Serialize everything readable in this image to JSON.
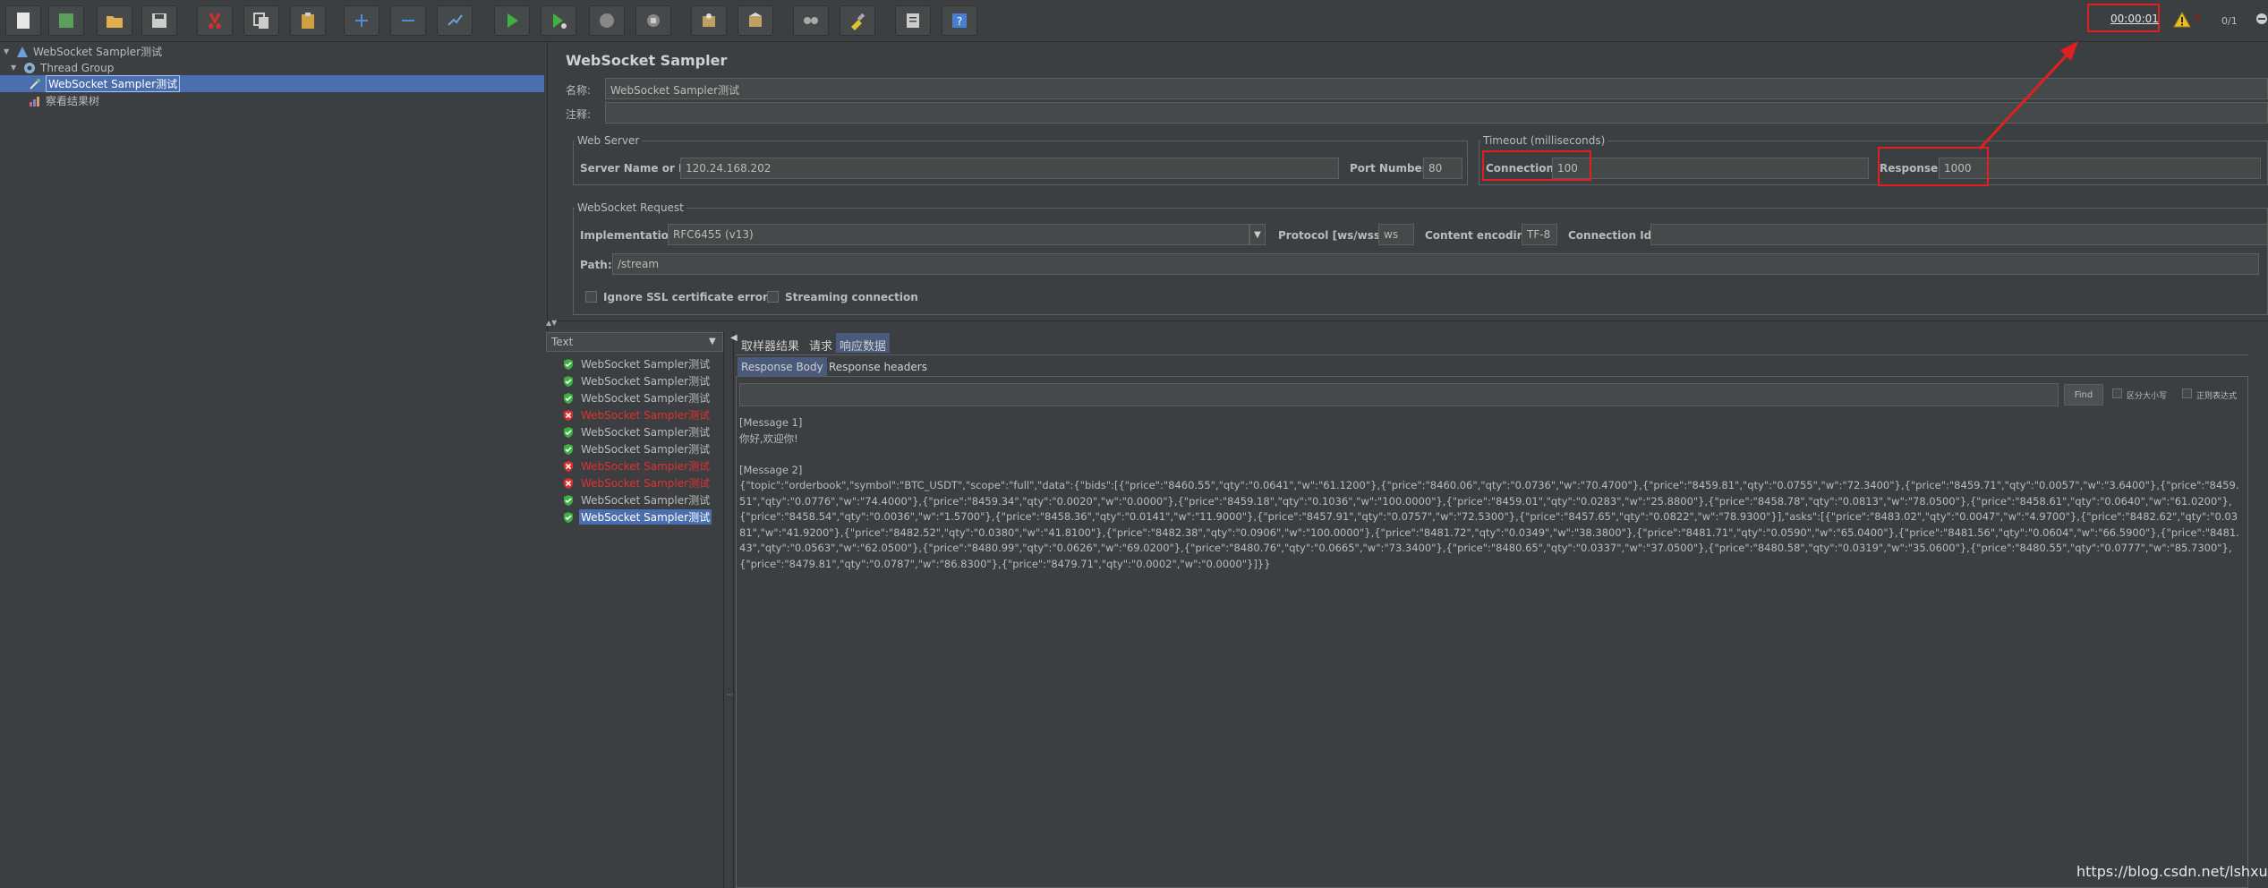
{
  "toolbar": {
    "buttons": [
      {
        "name": "new-icon",
        "color": "#e8e8e8"
      },
      {
        "name": "templates-icon",
        "color": "#5aa05a"
      },
      {
        "name": "open-icon",
        "color": "#e0b050"
      },
      {
        "name": "save-icon",
        "color": "#cccccc"
      },
      {
        "name": "cut-icon",
        "color": "#d03030"
      },
      {
        "name": "copy-icon",
        "color": "#cccccc"
      },
      {
        "name": "paste-icon",
        "color": "#d0a040"
      },
      {
        "name": "expand-icon",
        "color": "#4a8fd8"
      },
      {
        "name": "collapse-icon",
        "color": "#4a8fd8"
      },
      {
        "name": "toggle-icon",
        "color": "#6a9fd8"
      },
      {
        "name": "start-icon",
        "color": "#40b040"
      },
      {
        "name": "start-no-pauses-icon",
        "color": "#40b040"
      },
      {
        "name": "stop-icon",
        "color": "#888888"
      },
      {
        "name": "shutdown-icon",
        "color": "#888888"
      },
      {
        "name": "clear-icon",
        "color": "#c0a060"
      },
      {
        "name": "clear-all-icon",
        "color": "#c0a060"
      },
      {
        "name": "search-icon",
        "color": "#aaaaaa"
      },
      {
        "name": "reset-search-icon",
        "color": "#e0c030"
      },
      {
        "name": "function-helper-icon",
        "color": "#cccccc"
      },
      {
        "name": "help-icon",
        "color": "#4a7fd0"
      }
    ],
    "timer": "00:00:01",
    "warning_count": "0",
    "thread_count": "0/1"
  },
  "tree": {
    "items": [
      {
        "label": "WebSocket Sampler测试",
        "level": 0,
        "icon": "test-plan-icon"
      },
      {
        "label": "Thread Group",
        "level": 1,
        "icon": "thread-group-icon"
      },
      {
        "label": "WebSocket Sampler测试",
        "level": 2,
        "icon": "sampler-icon",
        "selected": true
      },
      {
        "label": "察看结果树",
        "level": 2,
        "icon": "listener-icon"
      }
    ]
  },
  "sampler": {
    "title": "WebSocket Sampler",
    "name_label": "名称:",
    "name_value": "WebSocket Sampler测试",
    "comment_label": "注释:",
    "comment_value": "",
    "web_server": {
      "legend": "Web Server",
      "server_label": "Server Name or IP:",
      "server_value": "120.24.168.202",
      "port_label": "Port Number:",
      "port_value": "80"
    },
    "timeout": {
      "legend": "Timeout (milliseconds)",
      "connection_label": "Connection:",
      "connection_value": "100",
      "response_label": "Response:",
      "response_value": "1000"
    },
    "request": {
      "legend": "WebSocket Request",
      "impl_label": "Implementation:",
      "impl_value": "RFC6455 (v13)",
      "protocol_label": "Protocol [ws/wss]:",
      "protocol_value": "ws",
      "encoding_label": "Content encoding:",
      "encoding_value": "TF-8",
      "conn_id_label": "Connection Id:",
      "conn_id_value": "",
      "path_label": "Path:",
      "path_value": "/stream",
      "ignore_ssl_label": "Ignore SSL certificate errors",
      "streaming_label": "Streaming connection"
    }
  },
  "results": {
    "renderer": "Text",
    "items": [
      {
        "label": "WebSocket Sampler测试",
        "status": "ok"
      },
      {
        "label": "WebSocket Sampler测试",
        "status": "ok"
      },
      {
        "label": "WebSocket Sampler测试",
        "status": "ok"
      },
      {
        "label": "WebSocket Sampler测试",
        "status": "err"
      },
      {
        "label": "WebSocket Sampler测试",
        "status": "ok"
      },
      {
        "label": "WebSocket Sampler测试",
        "status": "ok"
      },
      {
        "label": "WebSocket Sampler测试",
        "status": "err"
      },
      {
        "label": "WebSocket Sampler测试",
        "status": "err"
      },
      {
        "label": "WebSocket Sampler测试",
        "status": "ok"
      },
      {
        "label": "WebSocket Sampler测试",
        "status": "ok",
        "selected": true
      }
    ]
  },
  "response": {
    "tabs": [
      "取样器结果",
      "请求",
      "响应数据"
    ],
    "active_tab": 2,
    "subtabs": [
      "Response Body",
      "Response headers"
    ],
    "active_subtab": 0,
    "find_label": "Find",
    "case_sensitive_label": "区分大小写",
    "regex_label": "正则表达式",
    "lines": [
      "[Message 1]",
      "你好,欢迎你!",
      "",
      "[Message 2]",
      "{\"topic\":\"orderbook\",\"symbol\":\"BTC_USDT\",\"scope\":\"full\",\"data\":{\"bids\":[{\"price\":\"8460.55\",\"qty\":\"0.0641\",\"w\":\"61.1200\"},{\"price\":\"8460.06\",\"qty\":\"0.0736\",\"w\":\"70.4700\"},{\"price\":\"8459.81\",\"qty\":\"0.0755\",\"w\":\"72.3400\"},{\"price\":\"8459.71\",\"qty\":\"0.0057\",\"w\":\"3.6400\"},{\"price\":\"8459.51\",\"qty\":\"0.0776\",\"w\":\"74.4000\"},{\"price\":\"8459.34\",\"qty\":\"0.0020\",\"w\":\"0.0000\"},{\"price\":\"8459.18\",\"qty\":\"0.1036\",\"w\":\"100.0000\"},{\"price\":\"8459.01\",\"qty\":\"0.0283\",\"w\":\"25.8800\"},{\"price\":\"8458.78\",\"qty\":\"0.0813\",\"w\":\"78.0500\"},{\"price\":\"8458.61\",\"qty\":\"0.0640\",\"w\":\"61.0200\"},{\"price\":\"8458.54\",\"qty\":\"0.0036\",\"w\":\"1.5700\"},{\"price\":\"8458.36\",\"qty\":\"0.0141\",\"w\":\"11.9000\"},{\"price\":\"8457.91\",\"qty\":\"0.0757\",\"w\":\"72.5300\"},{\"price\":\"8457.65\",\"qty\":\"0.0822\",\"w\":\"78.9300\"}],\"asks\":[{\"price\":\"8483.02\",\"qty\":\"0.0047\",\"w\":\"4.9700\"},{\"price\":\"8482.62\",\"qty\":\"0.0381\",\"w\":\"41.9200\"},{\"price\":\"8482.52\",\"qty\":\"0.0380\",\"w\":\"41.8100\"},{\"price\":\"8482.38\",\"qty\":\"0.0906\",\"w\":\"100.0000\"},{\"price\":\"8481.72\",\"qty\":\"0.0349\",\"w\":\"38.3800\"},{\"price\":\"8481.71\",\"qty\":\"0.0590\",\"w\":\"65.0400\"},{\"price\":\"8481.56\",\"qty\":\"0.0604\",\"w\":\"66.5900\"},{\"price\":\"8481.43\",\"qty\":\"0.0563\",\"w\":\"62.0500\"},{\"price\":\"8480.99\",\"qty\":\"0.0626\",\"w\":\"69.0200\"},{\"price\":\"8480.76\",\"qty\":\"0.0665\",\"w\":\"73.3400\"},{\"price\":\"8480.65\",\"qty\":\"0.0337\",\"w\":\"37.0500\"},{\"price\":\"8480.58\",\"qty\":\"0.0319\",\"w\":\"35.0600\"},{\"price\":\"8480.55\",\"qty\":\"0.0777\",\"w\":\"85.7300\"},{\"price\":\"8479.81\",\"qty\":\"0.0787\",\"w\":\"86.8300\"},{\"price\":\"8479.71\",\"qty\":\"0.0002\",\"w\":\"0.0000\"}]}}"
    ]
  },
  "watermark": "https://blog.csdn.net/lshxuexi",
  "colors": {
    "background": "#3c3f41",
    "selection": "#4b6eaf",
    "annotation_red": "#e02020",
    "error_text": "#e03030",
    "ok_green": "#3cb043"
  }
}
